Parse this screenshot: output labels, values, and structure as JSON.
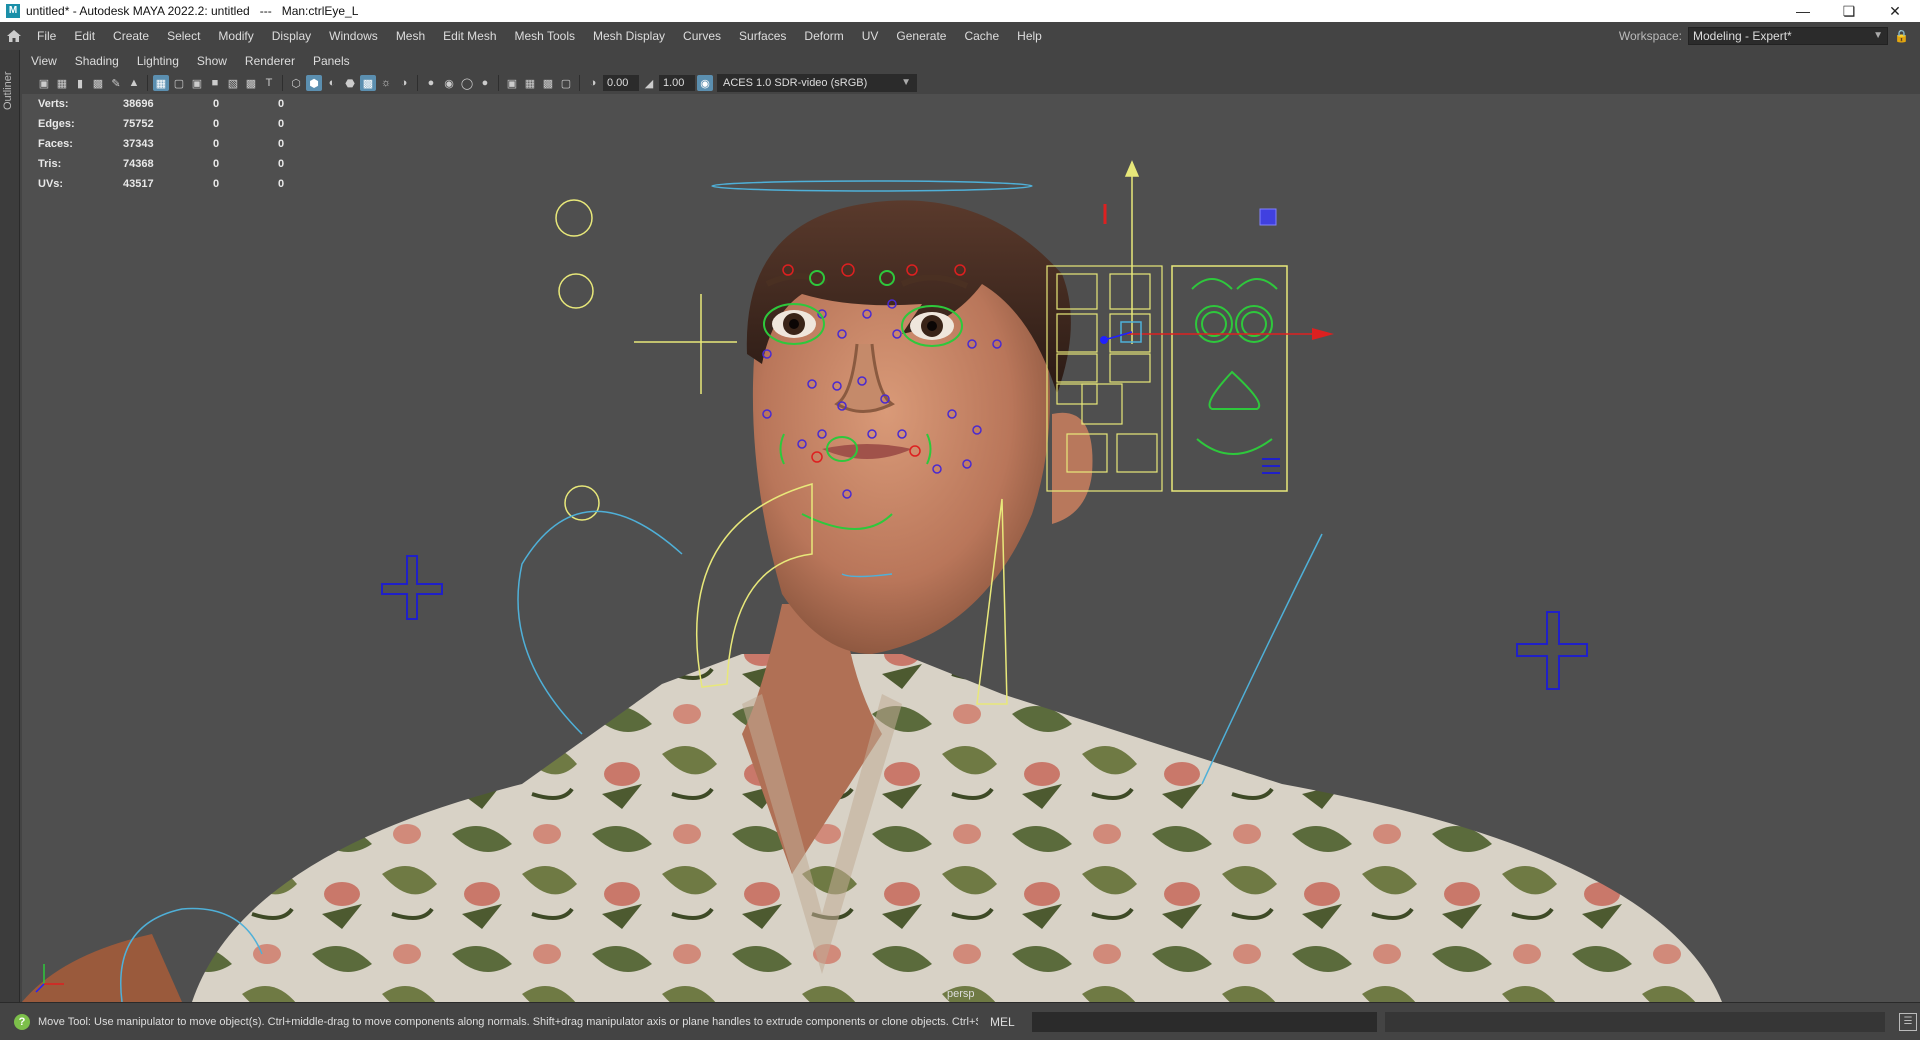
{
  "window": {
    "title": "untitled* - Autodesk MAYA 2022.2: untitled   ---   Man:ctrlEye_L",
    "app_icon": "M",
    "controls": [
      "minimize-icon",
      "restore-icon",
      "close-icon"
    ]
  },
  "menubar": {
    "items": [
      "File",
      "Edit",
      "Create",
      "Select",
      "Modify",
      "Display",
      "Windows",
      "Mesh",
      "Edit Mesh",
      "Mesh Tools",
      "Mesh Display",
      "Curves",
      "Surfaces",
      "Deform",
      "UV",
      "Generate",
      "Cache",
      "Help"
    ],
    "workspace_label": "Workspace:",
    "workspace_value": "Modeling - Expert*"
  },
  "outliner": {
    "label": "Outliner"
  },
  "panel_menu": [
    "View",
    "Shading",
    "Lighting",
    "Show",
    "Renderer",
    "Panels"
  ],
  "panel_toolbar": {
    "exposure": "0.00",
    "gamma": "1.00",
    "color_space": "ACES 1.0 SDR-video (sRGB)"
  },
  "hud": {
    "rows": [
      {
        "label": "Verts:",
        "v1": "38696",
        "v2": "0",
        "v3": "0"
      },
      {
        "label": "Edges:",
        "v1": "75752",
        "v2": "0",
        "v3": "0"
      },
      {
        "label": "Faces:",
        "v1": "37343",
        "v2": "0",
        "v3": "0"
      },
      {
        "label": "Tris:",
        "v1": "74368",
        "v2": "0",
        "v3": "0"
      },
      {
        "label": "UVs:",
        "v1": "43517",
        "v2": "0",
        "v3": "0"
      }
    ],
    "camera": "persp"
  },
  "status": {
    "help_text": "Move Tool: Use manipulator to move object(s). Ctrl+middle-drag to move components along normals. Shift+drag manipulator axis or plane handles to extrude components or clone objects. Ctrl+Shift+drag to con:",
    "command_language": "MEL"
  },
  "colors": {
    "viewport_bg": "#4f4f4f",
    "ui_bg": "#444444",
    "rig_yellow": "#e8e87a",
    "rig_green": "#2ec83c",
    "rig_blue": "#2020c8",
    "rig_red": "#dd2020"
  }
}
